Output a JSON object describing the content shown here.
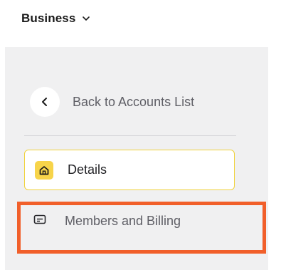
{
  "header": {
    "workspace_label": "Business"
  },
  "sidebar": {
    "back_label": "Back to Accounts List",
    "items": [
      {
        "label": "Details",
        "icon": "home-icon",
        "active": true
      },
      {
        "label": "Members and Billing",
        "icon": "card-icon",
        "active": false
      }
    ]
  },
  "colors": {
    "accent_yellow": "#f7d44a",
    "highlight_orange": "#f15f2a",
    "sidebar_bg": "#f0f0f1"
  }
}
